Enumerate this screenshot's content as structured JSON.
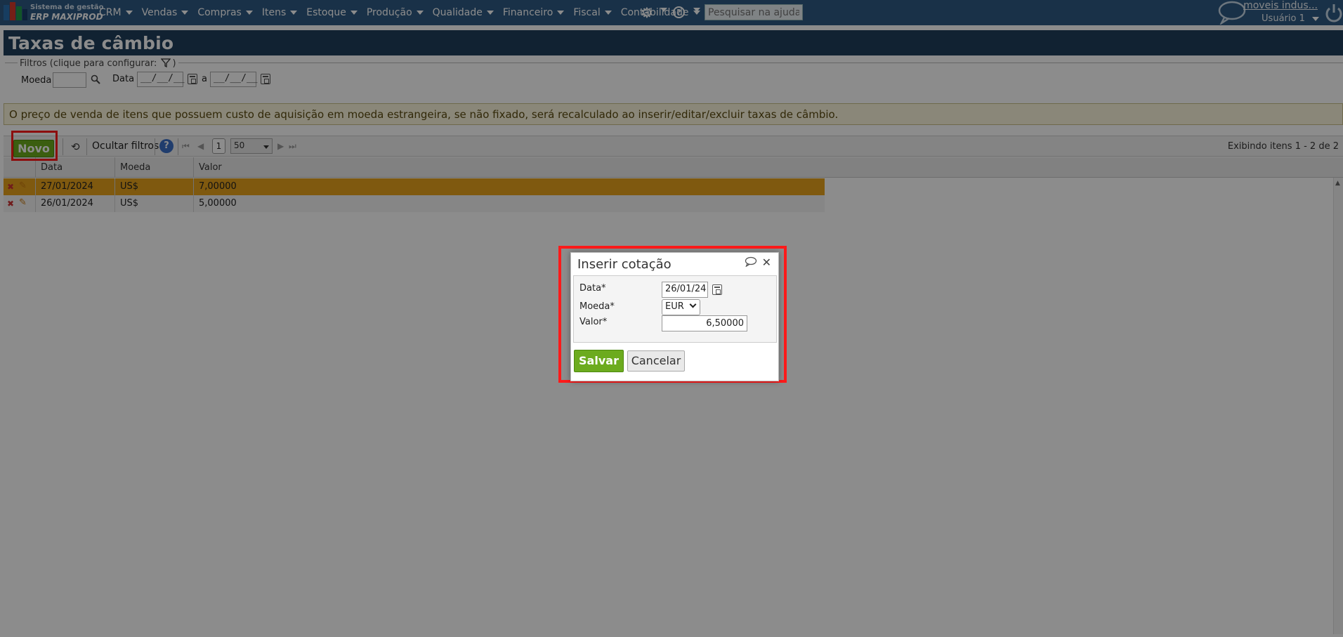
{
  "app": {
    "logo_line1": "Sistema de gestão",
    "logo_line2": "ERP MAXIPROD",
    "menu": [
      "CRM",
      "Vendas",
      "Compras",
      "Itens",
      "Estoque",
      "Produção",
      "Qualidade",
      "Financeiro",
      "Fiscal",
      "Contabilidade"
    ],
    "help_search_placeholder": "Pesquisar na ajuda...",
    "company_link": "moveis indus...",
    "user": "Usuário 1"
  },
  "page": {
    "title": "Taxas de câmbio"
  },
  "filters": {
    "legend": "Filtros (clique para configurar:",
    "legend_close": ")",
    "moeda_label": "Moeda",
    "moeda_value": "",
    "data_label": "Data",
    "data_from": "__/__/__",
    "data_sep": "a",
    "data_to": "__/__/__"
  },
  "notice": "O preço de venda de itens que possuem custo de aquisição em moeda estrangeira, se não fixado, será recalculado ao inserir/editar/excluir taxas de câmbio.",
  "toolbar": {
    "novo_label": "Novo",
    "ocultar_label": "Ocultar filtros",
    "page": "1",
    "page_size": "50",
    "items_count": "Exibindo itens 1 - 2 de 2"
  },
  "grid": {
    "columns": [
      "Data",
      "Moeda",
      "Valor"
    ],
    "rows": [
      {
        "data": "27/01/2024",
        "moeda": "US$",
        "valor": "7,00000",
        "selected": true
      },
      {
        "data": "26/01/2024",
        "moeda": "US$",
        "valor": "5,00000",
        "selected": false
      }
    ]
  },
  "dialog": {
    "title": "Inserir cotação",
    "data_label": "Data*",
    "data_value": "26/01/24",
    "moeda_label": "Moeda*",
    "moeda_value": "EUR",
    "valor_label": "Valor*",
    "valor_value": "6,50000",
    "salvar_label": "Salvar",
    "cancelar_label": "Cancelar"
  },
  "colors": {
    "topbar": "#2e5a83",
    "header": "#1f3e5c",
    "accent_green": "#6cab1e",
    "highlight_red": "#ff1a1a",
    "selected_row": "#e8a21c"
  }
}
